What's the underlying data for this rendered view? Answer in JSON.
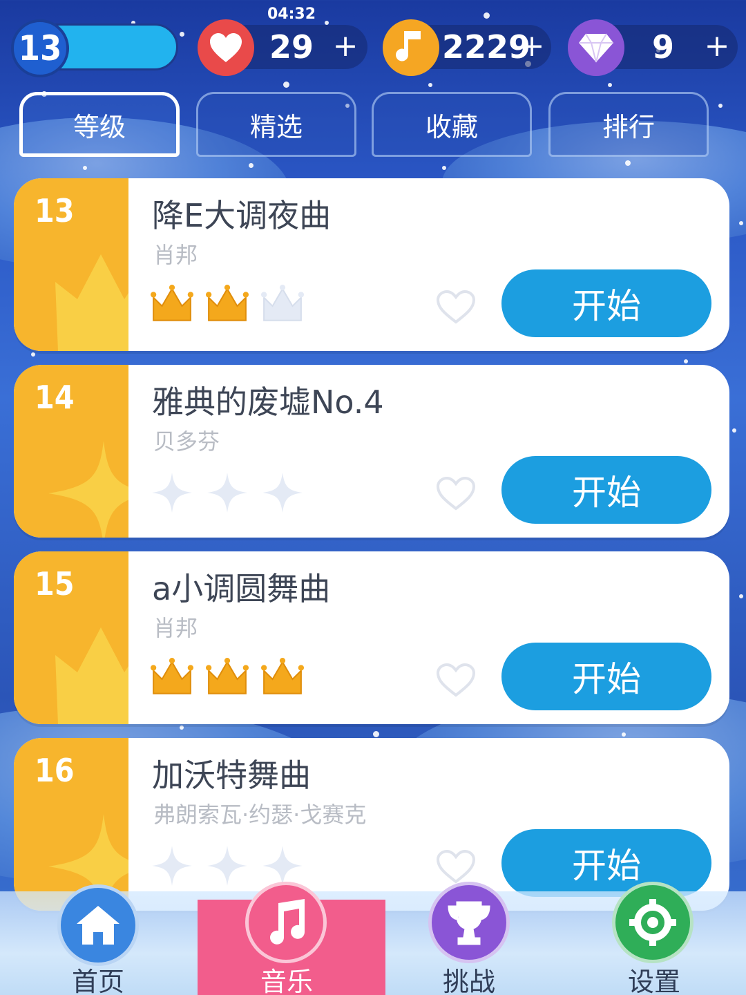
{
  "status": {
    "clock": "04:32",
    "level": "13",
    "lives": "29",
    "notes": "2229",
    "gems": "9",
    "plus": "+"
  },
  "tabs": [
    {
      "label": "等级",
      "active": true
    },
    {
      "label": "精选",
      "active": false
    },
    {
      "label": "收藏",
      "active": false
    },
    {
      "label": "排行",
      "active": false
    }
  ],
  "songs": [
    {
      "level": "13",
      "title": "降E大调夜曲",
      "artist": "肖邦",
      "rating_type": "crowns",
      "earned": 2,
      "total": 3,
      "start_label": "开始"
    },
    {
      "level": "14",
      "title": "雅典的废墟No.4",
      "artist": "贝多芬",
      "rating_type": "stars",
      "earned": 0,
      "total": 3,
      "start_label": "开始"
    },
    {
      "level": "15",
      "title": "a小调圆舞曲",
      "artist": "肖邦",
      "rating_type": "crowns",
      "earned": 3,
      "total": 3,
      "start_label": "开始"
    },
    {
      "level": "16",
      "title": "加沃特舞曲",
      "artist": "弗朗索瓦·约瑟·戈赛克",
      "rating_type": "stars",
      "earned": 0,
      "total": 3,
      "start_label": "开始"
    }
  ],
  "nav": [
    {
      "label": "首页",
      "icon": "home-icon",
      "color": "#3a86e0",
      "active": false
    },
    {
      "label": "音乐",
      "icon": "music-note-icon",
      "color": "#f25d8c",
      "active": true
    },
    {
      "label": "挑战",
      "icon": "trophy-icon",
      "color": "#8a55d6",
      "active": false
    },
    {
      "label": "设置",
      "icon": "settings-icon",
      "color": "#2fae58",
      "active": false
    }
  ],
  "colors": {
    "accent_blue": "#1c9ee0",
    "card_side": "#f7b52d",
    "crown_gold": "#f4a81c",
    "heart_red": "#e94a4a",
    "note_orange": "#f5a623",
    "gem_purple": "#8a55d6"
  }
}
